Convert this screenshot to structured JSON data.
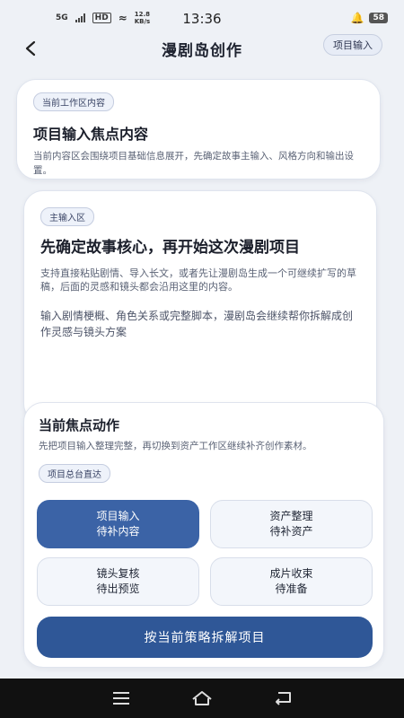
{
  "status": {
    "network": "5G",
    "hd": "HD",
    "speed": "12.8 KB/s",
    "time": "13:36",
    "battery": "58"
  },
  "header": {
    "title": "漫剧岛创作",
    "pill": "项目输入"
  },
  "card1": {
    "tag": "当前工作区内容",
    "title": "项目输入焦点内容",
    "desc": "当前内容区会围绕项目基础信息展开，先确定故事主输入、风格方向和输出设置。"
  },
  "card2": {
    "tag": "主输入区",
    "title": "先确定故事核心，再开始这次漫剧项目",
    "desc": "支持直接粘贴剧情、导入长文，或者先让漫剧岛生成一个可继续扩写的草稿，后面的灵感和镜头都会沿用这里的内容。",
    "desc2": "输入剧情梗概、角色关系或完整脚本，漫剧岛会继续帮你拆解成创作灵感与镜头方案"
  },
  "card3": {
    "title": "当前焦点动作",
    "desc": "先把项目输入整理完整，再切换到资产工作区继续补齐创作素材。",
    "tag": "项目总台直达",
    "actions": [
      {
        "line1": "项目输入",
        "line2": "待补内容"
      },
      {
        "line1": "资产整理",
        "line2": "待补资产"
      },
      {
        "line1": "镜头复核",
        "line2": "待出预览"
      },
      {
        "line1": "成片收束",
        "line2": "待准备"
      }
    ],
    "main_button": "按当前策略拆解项目"
  },
  "colors": {
    "primary": "#3b63a6",
    "primary_dark": "#2f5797",
    "background": "#eef1f6"
  }
}
